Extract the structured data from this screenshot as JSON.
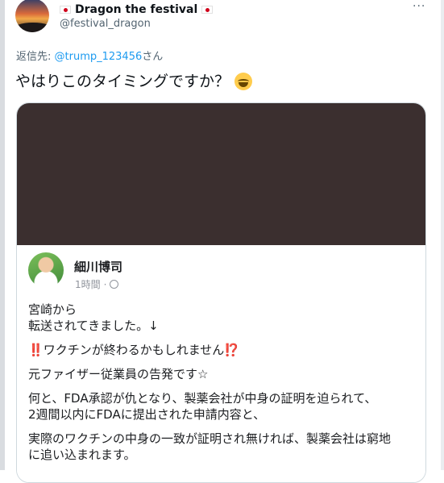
{
  "tweet": {
    "display_name": "Dragon the festival",
    "handle": "@festival_dragon",
    "more_label": "···",
    "reply_prefix": "返信先: ",
    "reply_handle": "@trump_123456",
    "reply_suffix": "さん",
    "text": "やはりこのタイミングですか？"
  },
  "fb": {
    "name": "細川博司",
    "time": "1時間",
    "sep": "·",
    "line1": "宮崎から",
    "line2": "転送されてきました。↓",
    "warn_pre": "‼️",
    "warn_text": "ワクチンが終わるかもしれません",
    "warn_post": "⁉️",
    "line4": "元ファイザー従業員の告発です☆",
    "line5": "何と、FDA承認が仇となり、製薬会社が中身の証明を迫られて、",
    "line6": "2週間以内にFDAに提出された申請内容と、",
    "line7": "実際のワクチンの中身の一致が証明され無ければ、製薬会社は窮地",
    "line8": "に追い込まれます。"
  }
}
